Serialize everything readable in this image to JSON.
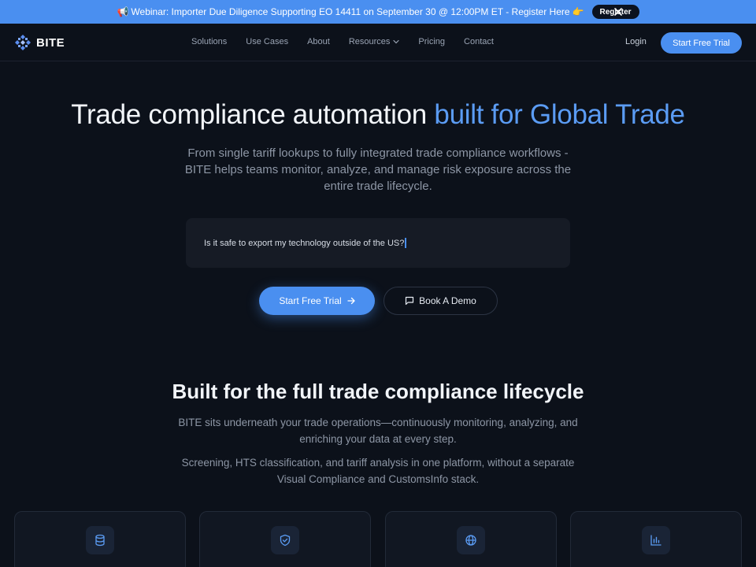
{
  "announcement": {
    "text": "Webinar: Importer Due Diligence Supporting EO 14411 on September 30 @ 12:00PM ET - Register Here",
    "register_label": "Register",
    "close_label": "✕"
  },
  "nav": {
    "brand": "BITE",
    "links": [
      "Solutions",
      "Use Cases",
      "About",
      "Resources",
      "Pricing",
      "Contact"
    ],
    "login": "Login",
    "cta": "Start Free Trial"
  },
  "hero": {
    "title_plain": "Trade compliance automation ",
    "title_accent": "built for Global Trade",
    "subtitle": "From single tariff lookups to fully integrated trade compliance workflows - BITE helps teams monitor, analyze, and manage risk exposure across the entire trade lifecycle.",
    "query": "Is it safe to export my technology outside of the US?",
    "primary_cta": "Start Free Trial",
    "secondary_cta": "Book A Demo"
  },
  "section": {
    "title": "Built for the full trade compliance lifecycle",
    "p1": "BITE sits underneath your trade operations—continuously monitoring, analyzing, and enriching your data at every step.",
    "p2": "Screening, HTS classification, and tariff analysis in one platform, without a separate Visual Compliance and CustomsInfo stack."
  },
  "cards": [
    {
      "icon": "database-icon"
    },
    {
      "icon": "shield-icon"
    },
    {
      "icon": "globe-icon"
    },
    {
      "icon": "bar-chart-icon"
    }
  ],
  "colors": {
    "accent": "#4a8ff0",
    "background": "#0c111a",
    "announcement_bg": "#4a8ff0"
  }
}
